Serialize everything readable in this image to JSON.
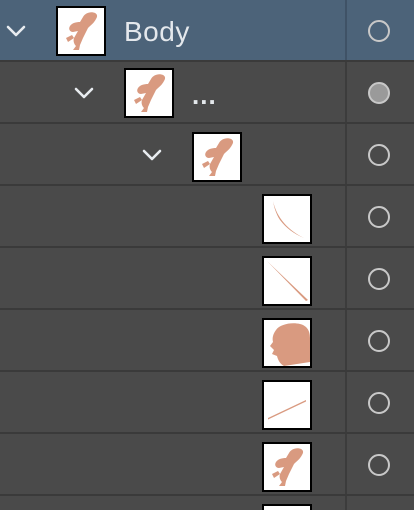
{
  "colors": {
    "panel_bg": "#4a4a4a",
    "selected_bg": "#4c6379",
    "skin": "#d99a80",
    "label_text": "#e4e8ec",
    "visibility_ring": "#c8c8c8"
  },
  "layers": [
    {
      "label": "Body",
      "depth": 0,
      "expanded": true,
      "selected": true,
      "visible": false,
      "thumb_icon": "crouching-figure-icon"
    },
    {
      "label": "...",
      "depth": 1,
      "expanded": true,
      "selected": false,
      "visible": true,
      "thumb_icon": "crouching-figure-icon"
    },
    {
      "label": "",
      "depth": 2,
      "expanded": true,
      "selected": false,
      "visible": false,
      "thumb_icon": "crouching-figure-icon"
    },
    {
      "label": "",
      "depth": 3,
      "expanded": false,
      "selected": false,
      "visible": false,
      "thumb_icon": "curved-stroke-icon"
    },
    {
      "label": "",
      "depth": 3,
      "expanded": false,
      "selected": false,
      "visible": false,
      "thumb_icon": "diagonal-line-icon"
    },
    {
      "label": "",
      "depth": 3,
      "expanded": false,
      "selected": false,
      "visible": false,
      "thumb_icon": "head-silhouette-icon"
    },
    {
      "label": "",
      "depth": 3,
      "expanded": false,
      "selected": false,
      "visible": false,
      "thumb_icon": "thin-line-icon"
    },
    {
      "label": "",
      "depth": 3,
      "expanded": false,
      "selected": false,
      "visible": false,
      "thumb_icon": "crouching-figure-icon"
    }
  ]
}
